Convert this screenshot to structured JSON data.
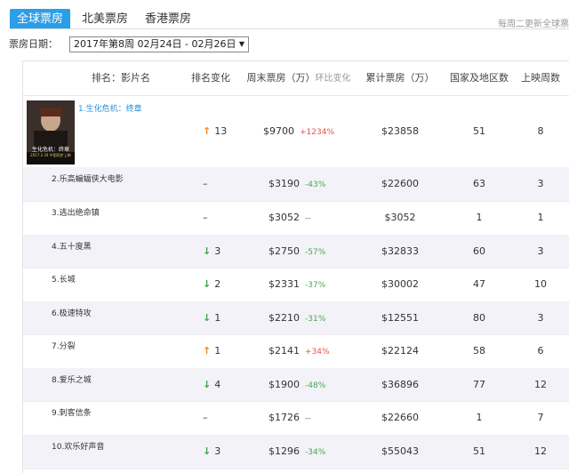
{
  "tabs": [
    {
      "label": "全球票房",
      "active": true
    },
    {
      "label": "北美票房",
      "active": false
    },
    {
      "label": "香港票房",
      "active": false
    }
  ],
  "update_note": "每周二更新全球票",
  "date": {
    "label": "票房日期：",
    "selected": "2017年第8周 02月24日 - 02月26日"
  },
  "columns": {
    "rank_title": "排名：影片名",
    "rank_change": "排名变化",
    "weekend": "周末票房（万）",
    "weekend_sub": "环比变化",
    "total": "累计票房（万）",
    "regions": "国家及地区数",
    "weeks": "上映周数"
  },
  "poster": {
    "title": "生化危机：终章",
    "subtitle": "2017.2.24 中国同步上映"
  },
  "rows": [
    {
      "name": "1.生化危机：终章",
      "trend": "up",
      "change": "13",
      "weekend": "$9700",
      "pct": "+1234%",
      "total": "$23858",
      "regions": "51",
      "weeks": "8"
    },
    {
      "name": "2.乐高蝙蝠侠大电影",
      "trend": "none",
      "change": "",
      "weekend": "$3190",
      "pct": "-43%",
      "total": "$22600",
      "regions": "63",
      "weeks": "3"
    },
    {
      "name": "3.逃出绝命镇",
      "trend": "none",
      "change": "",
      "weekend": "$3052",
      "pct": "--",
      "total": "$3052",
      "regions": "1",
      "weeks": "1"
    },
    {
      "name": "4.五十度黑",
      "trend": "down",
      "change": "3",
      "weekend": "$2750",
      "pct": "-57%",
      "total": "$32833",
      "regions": "60",
      "weeks": "3"
    },
    {
      "name": "5.长城",
      "trend": "down",
      "change": "2",
      "weekend": "$2331",
      "pct": "-37%",
      "total": "$30002",
      "regions": "47",
      "weeks": "10"
    },
    {
      "name": "6.极速特攻",
      "trend": "down",
      "change": "1",
      "weekend": "$2210",
      "pct": "-31%",
      "total": "$12551",
      "regions": "80",
      "weeks": "3"
    },
    {
      "name": "7.分裂",
      "trend": "up",
      "change": "1",
      "weekend": "$2141",
      "pct": "+34%",
      "total": "$22124",
      "regions": "58",
      "weeks": "6"
    },
    {
      "name": "8.爱乐之城",
      "trend": "down",
      "change": "4",
      "weekend": "$1900",
      "pct": "-48%",
      "total": "$36896",
      "regions": "77",
      "weeks": "12"
    },
    {
      "name": "9.刺客信条",
      "trend": "none",
      "change": "",
      "weekend": "$1726",
      "pct": "--",
      "total": "$22660",
      "regions": "1",
      "weeks": "7"
    },
    {
      "name": "10.欢乐好声音",
      "trend": "down",
      "change": "3",
      "weekend": "$1296",
      "pct": "-34%",
      "total": "$55043",
      "regions": "51",
      "weeks": "12"
    }
  ],
  "colors": {
    "accent": "#2a9ee8",
    "up": "#f28a1f",
    "down": "#3aa648",
    "pct_up": "#e8504c",
    "pct_down": "#4aa84e"
  }
}
